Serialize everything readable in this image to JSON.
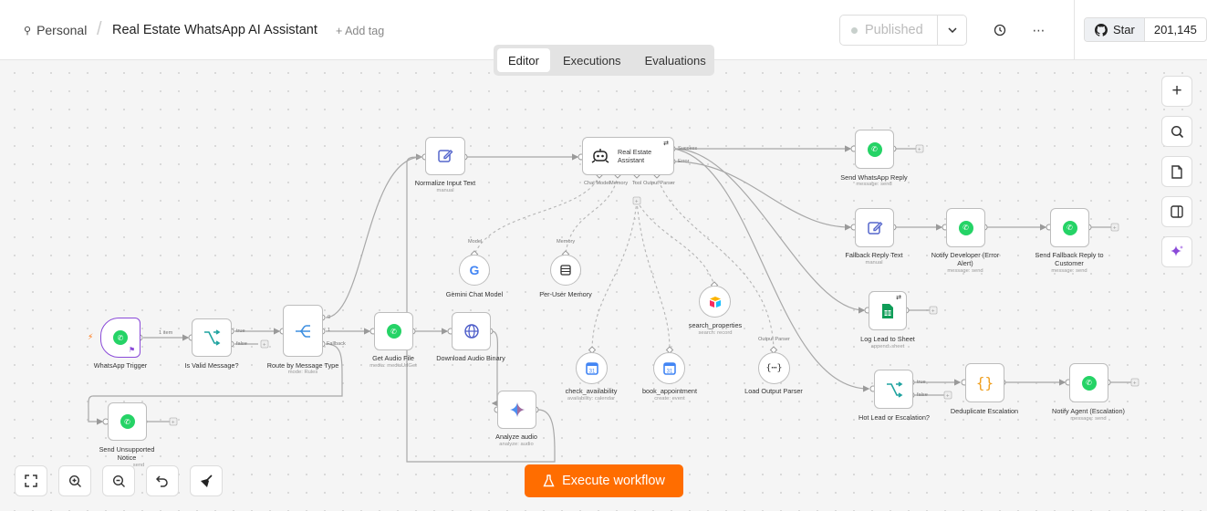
{
  "header": {
    "breadcrumb_root": "Personal",
    "workflow_title": "Real Estate WhatsApp AI Assistant",
    "add_tag": "+ Add tag",
    "published_label": "Published",
    "github_star_label": "Star",
    "github_star_count": "201,145"
  },
  "tabs": [
    {
      "label": "Editor",
      "active": true
    },
    {
      "label": "Executions",
      "active": false
    },
    {
      "label": "Evaluations",
      "active": false
    }
  ],
  "nodes": {
    "whatsapp_trigger": {
      "label": "WhatsApp Trigger"
    },
    "is_valid_message": {
      "label": "Is Valid Message?"
    },
    "route_by_type": {
      "label": "Route by Message Type",
      "sub": "mode: Rules"
    },
    "normalize_input": {
      "label": "Normalize Input Text",
      "sub": "manual"
    },
    "get_audio_file": {
      "label": "Get Audio File",
      "sub": "media: mediaUrlGet"
    },
    "download_audio": {
      "label": "Download Audio Binary"
    },
    "analyze_audio": {
      "label": "Analyze audio",
      "sub": "analyze: audio"
    },
    "send_unsupported": {
      "label_line1": "Send Unsupported",
      "label_line2": "Notice",
      "sub": "send"
    },
    "agent": {
      "label_line1": "Real Estate",
      "label_line2": "Assistant"
    },
    "gemini": {
      "label": "Gemini Chat Model"
    },
    "memory": {
      "label": "Per-User Memory"
    },
    "search_properties": {
      "label": "search_properties",
      "sub": "search: record"
    },
    "check_availability": {
      "label": "check_availability",
      "sub": "availability: calendar"
    },
    "book_appointment": {
      "label": "book_appointment",
      "sub": "create: event"
    },
    "output_parser": {
      "label": "Load Output Parser"
    },
    "send_reply": {
      "label": "Send WhatsApp Reply",
      "sub": "message: send"
    },
    "fallback_text": {
      "label": "Fallback Reply Text",
      "sub": "manual"
    },
    "notify_dev": {
      "label_line1": "Notify Developer (Error",
      "label_line2": "Alert)",
      "sub": "message: send"
    },
    "send_fallback": {
      "label_line1": "Send Fallback Reply to",
      "label_line2": "Customer",
      "sub": "message: send"
    },
    "log_lead": {
      "label": "Log Lead to Sheet",
      "sub": "append: sheet"
    },
    "hot_lead": {
      "label": "Hot Lead or Escalation?"
    },
    "dedupe": {
      "label": "Deduplicate Escalation"
    },
    "notify_agent": {
      "label": "Notify Agent (Escalation)",
      "sub": "message: send"
    }
  },
  "edge_labels": {
    "one_item": "1 item",
    "true": "true",
    "false": "false",
    "route_0": "0",
    "route_1": "1",
    "fallback": "Fallback",
    "success": "Success",
    "error": "Error",
    "chat_model": "Chat Model",
    "memory": "Memory",
    "tool": "Tool",
    "output_parser": "Output Parser",
    "model": "Model",
    "memory_top": "Memory",
    "output_parser_top": "Output Parser",
    "true2": "true",
    "false2": "false"
  },
  "execute_button": "Execute workflow",
  "colors": {
    "accent": "#ff6d00",
    "whatsapp": "#25d366",
    "trigger_border": "#8a4ad8"
  }
}
